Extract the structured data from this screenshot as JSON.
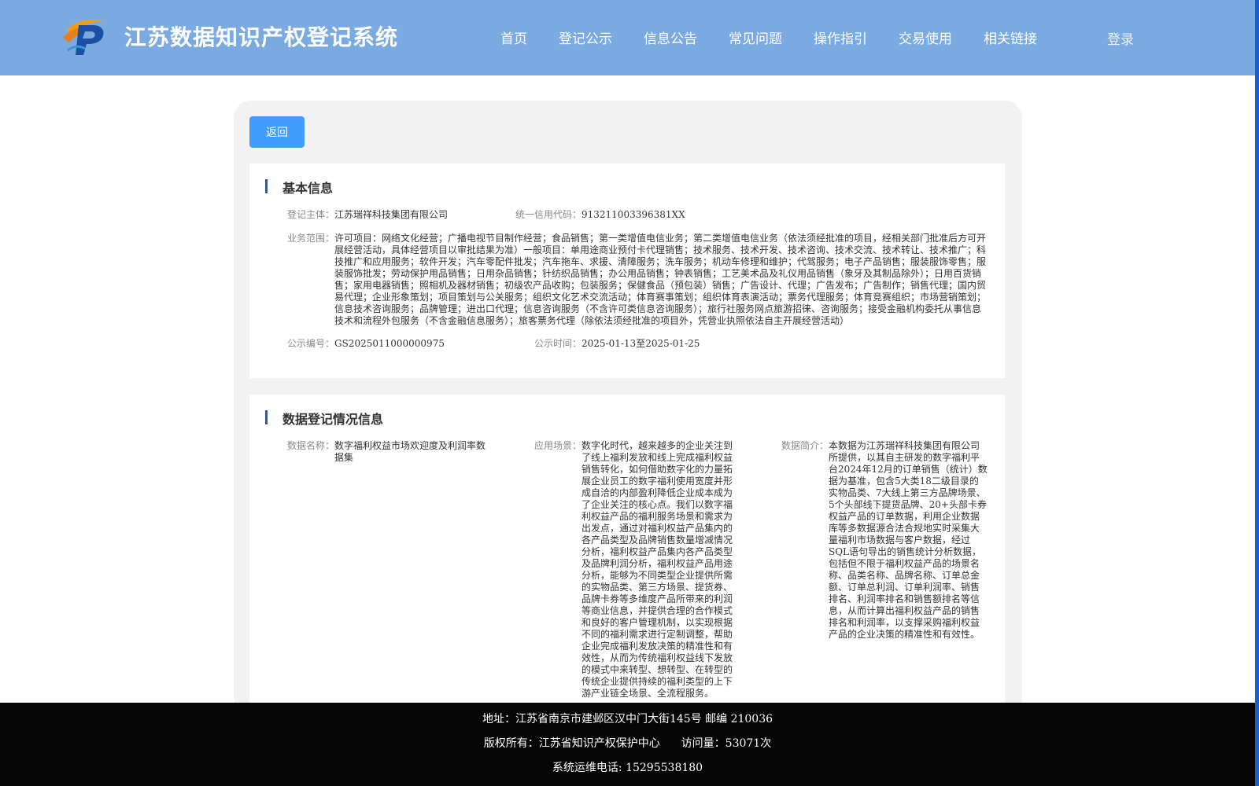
{
  "header": {
    "title": "江苏数据知识产权登记系统",
    "nav": [
      "首页",
      "登记公示",
      "信息公告",
      "常见问题",
      "操作指引",
      "交易使用",
      "相关链接"
    ],
    "login": "登录"
  },
  "colors": {
    "header": "#7aaadf",
    "button": "#409eff",
    "accent": "#1f5db4",
    "footer": "#050505"
  },
  "back_button": "返回",
  "basic": {
    "title": "基本信息",
    "subject_label": "登记主体：",
    "subject_value": "江苏瑞祥科技集团有限公司",
    "credit_label": "统一信用代码：",
    "credit_value": "913211003396381XX",
    "scope_label": "业务范围：",
    "scope_value": "许可项目：网络文化经营；广播电视节目制作经营；食品销售；第一类增值电信业务；第二类增值电信业务（依法须经批准的项目，经相关部门批准后方可开展经营活动，具体经营项目以审批结果为准）一般项目：单用途商业预付卡代理销售；技术服务、技术开发、技术咨询、技术交流、技术转让、技术推广；科技推广和应用服务；软件开发；汽车零配件批发；汽车拖车、求援、清障服务；洗车服务；机动车修理和维护；代驾服务；电子产品销售；服装服饰零售；服装服饰批发；劳动保护用品销售；日用杂品销售；针纺织品销售；办公用品销售；钟表销售；工艺美术品及礼仪用品销售（象牙及其制品除外）；日用百货销售；家用电器销售；照相机及器材销售；初级农产品收购；包装服务；保健食品（预包装）销售；广告设计、代理；广告发布；广告制作；销售代理；国内贸易代理；企业形象策划；项目策划与公关服务；组织文化艺术交流活动；体育赛事策划；组织体育表演活动；票务代理服务；体育竞赛组织；市场营销策划；信息技术咨询服务；品牌管理；进出口代理；信息咨询服务（不含许可类信息咨询服务）；旅行社服务网点旅游招徕、咨询服务；接受金融机构委托从事信息技术和流程外包服务（不含金融信息服务）；旅客票务代理（除依法须经批准的项目外，凭营业执照依法自主开展经营活动）",
    "number_label": "公示编号：",
    "number_value": "GS2025011000000975",
    "time_label": "公示时间：",
    "time_value": "2025-01-13至2025-01-25"
  },
  "data_reg": {
    "title": "数据登记情况信息",
    "name_label": "数据名称：",
    "name_value": "数字福利权益市场欢迎度及利润率数据集",
    "scene_label": "应用场景：",
    "scene_value": "数字化时代，越来越多的企业关注到了线上福利发放和线上完成福利权益销售转化，如何借助数字化的力量拓展企业员工的数字福利使用宽度并形成自洽的内部盈利降低企业成本成为了企业关注的核心点。我们以数字福利权益产品的福利服务场景和需求为出发点，通过对福利权益产品集内的各产品类型及品牌销售数量增减情况分析，福利权益产品集内各产品类型及品牌利润分析，福利权益产品用途分析，能够为不同类型企业提供所需的实物品类、第三方场景、提货券、品牌卡券等多维度产品所带来的利润等商业信息，并提供合理的合作模式和良好的客户管理机制，以实现根据不同的福利需求进行定制调整，帮助企业完成福利发放决策的精准性和有效性，从而为传统福利权益线下发放的模式中来转型、想转型、在转型的传统企业提供持续的福利类型的上下游产业链全场景、全流程服务。",
    "intro_label": "数据简介：",
    "intro_value": "本数据为江苏瑞祥科技集团有限公司所提供，以其自主研发的数字福利平台2024年12月的订单销售（统计）数据为基准，包含5大类18二级目录的实物品类、7大线上第三方品牌场景、5个头部线下提货品牌、20+头部卡券权益产品的订单数据，利用企业数据库等多数据源合法合规地实时采集大量福利市场数据与客户数据，经过SQL语句导出的销售统计分析数据，包括但不限于福利权益产品的场景名称、品类名称、品牌名称、订单总金额、订单总利润、订单利润率、销售排名、利润率排名和销售额排名等信息，从而计算出福利权益产品的销售排名和利润率，以支撑采购福利权益产品的企业决策的精准性和有效性。"
  },
  "footer": {
    "address": "地址：江苏省南京市建邺区汉中门大街145号 邮编 210036",
    "copyright": "版权所有：江苏省知识产权保护中心",
    "visits": "访问量：53071次",
    "phone": "系统运维电话: 15295538180"
  }
}
